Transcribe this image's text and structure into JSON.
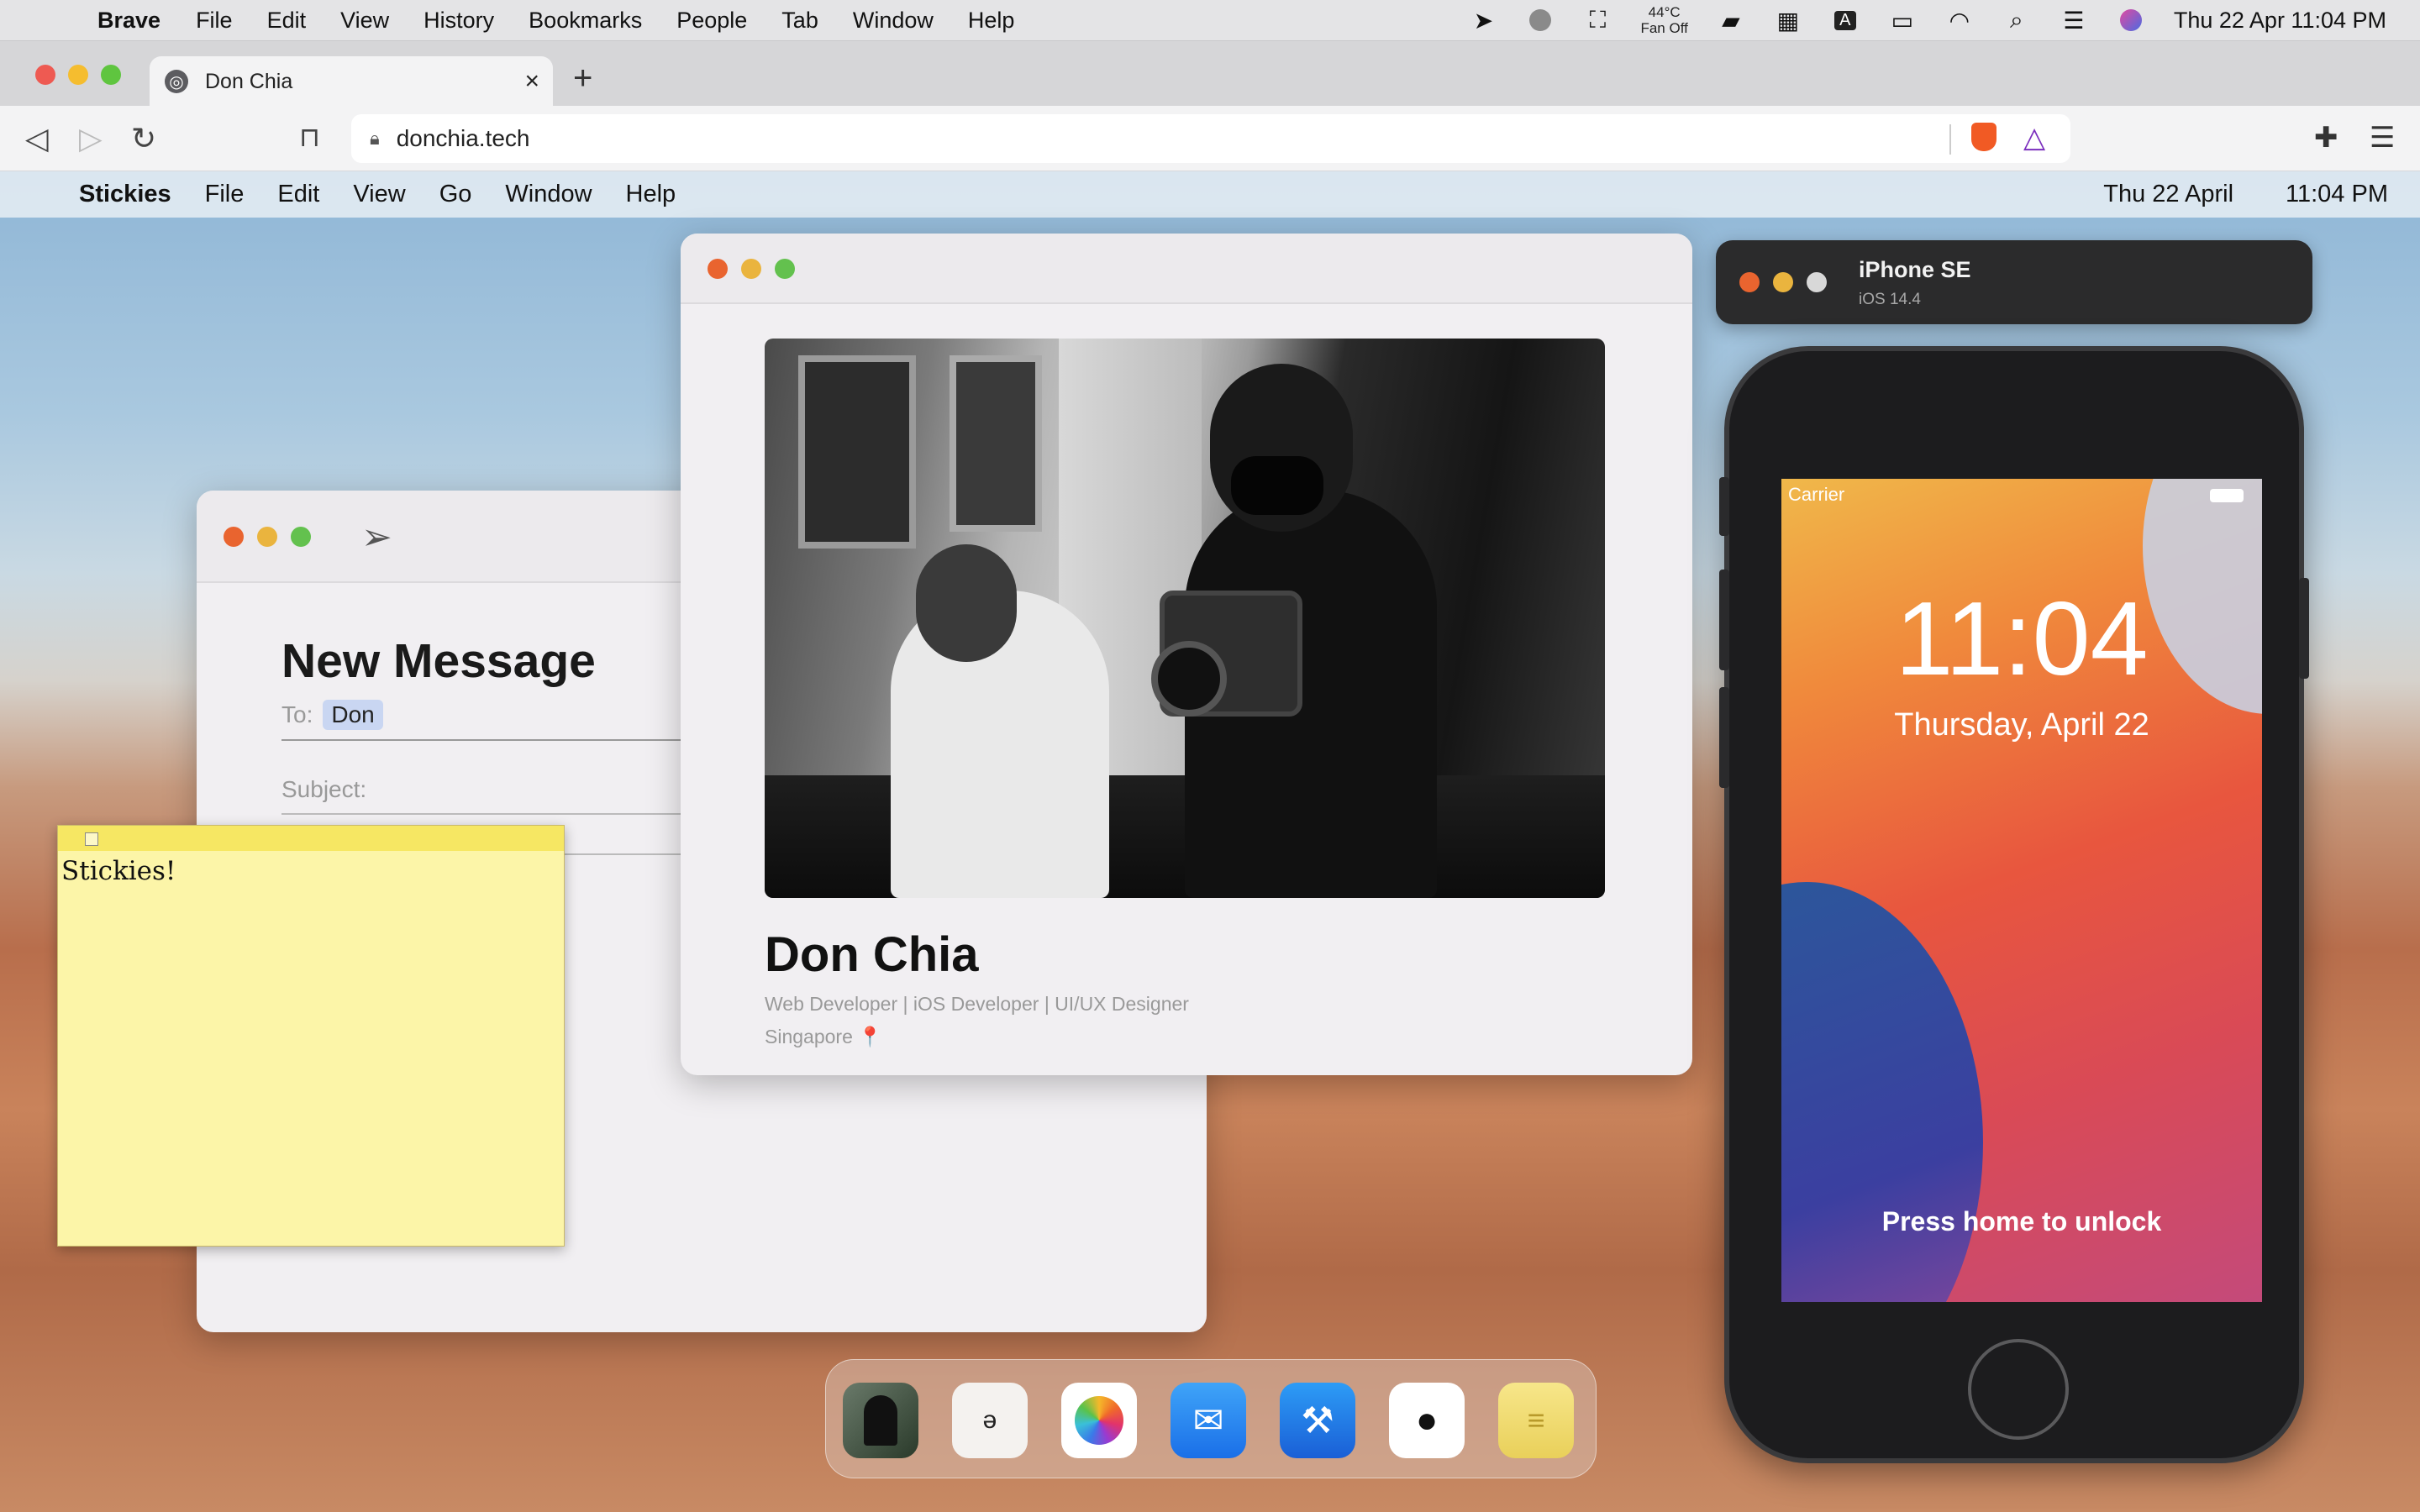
{
  "system_menubar": {
    "app_name": "Brave",
    "menus": [
      "File",
      "Edit",
      "View",
      "History",
      "Bookmarks",
      "People",
      "Tab",
      "Window",
      "Help"
    ],
    "temperature": "44°C",
    "fan_status": "Fan Off",
    "datetime": "Thu 22 Apr  11:04 PM"
  },
  "browser": {
    "tab_title": "Don Chia",
    "url": "donchia.tech"
  },
  "desktop_menubar": {
    "app_name": "Stickies",
    "menus": [
      "File",
      "Edit",
      "View",
      "Go",
      "Window",
      "Help"
    ],
    "date": "Thu 22 April",
    "time": "11:04 PM"
  },
  "mail": {
    "heading": "New Message",
    "to_label": "To:",
    "to_recipient": "Don",
    "subject_label": "Subject:"
  },
  "sticky": {
    "text": "Stickies!"
  },
  "profile": {
    "name": "Don Chia",
    "roles": "Web Developer | iOS Developer | UI/UX Designer",
    "location": "Singapore",
    "location_icon": "📍"
  },
  "simulator": {
    "device": "iPhone SE",
    "os": "iOS 14.4",
    "carrier": "Carrier",
    "time": "11:04",
    "date": "Thursday, April 22",
    "unlock_hint": "Press home to unlock"
  },
  "dock": {
    "apps": [
      "profile-photo-app",
      "dictionary-app",
      "photos-app",
      "mail-app",
      "xcode-app",
      "github-app",
      "notes-app"
    ]
  }
}
